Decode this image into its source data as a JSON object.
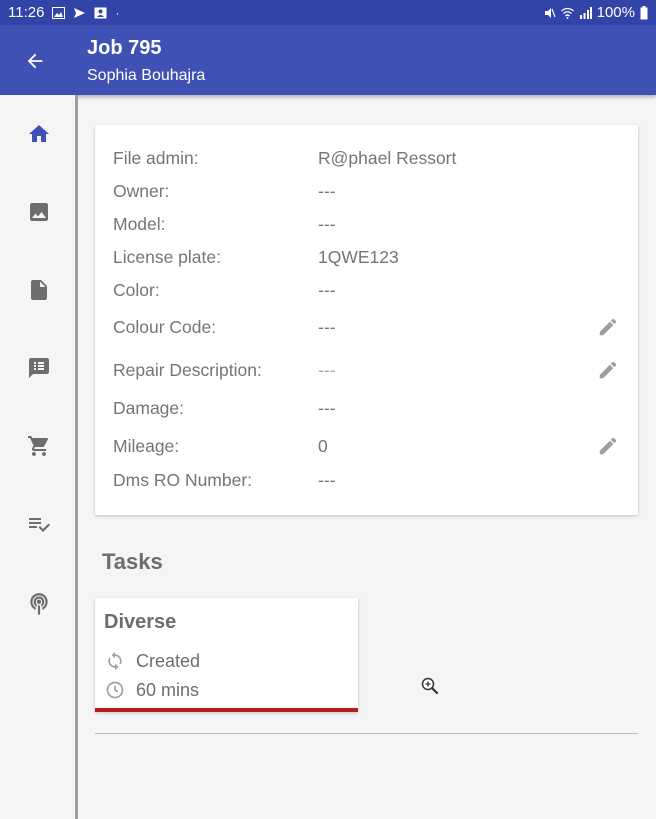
{
  "status_bar": {
    "time": "11:26",
    "battery": "100%"
  },
  "app_bar": {
    "title": "Job 795",
    "subtitle": "Sophia Bouhajra",
    "back_icon": "arrow-back-icon"
  },
  "nav": {
    "items": [
      {
        "name": "home",
        "icon": "home-icon",
        "active": true
      },
      {
        "name": "images",
        "icon": "image-icon",
        "active": false
      },
      {
        "name": "documents",
        "icon": "document-icon",
        "active": false
      },
      {
        "name": "messages",
        "icon": "message-icon",
        "active": false
      },
      {
        "name": "cart",
        "icon": "cart-icon",
        "active": false
      },
      {
        "name": "checklist",
        "icon": "checklist-icon",
        "active": false
      },
      {
        "name": "podcast",
        "icon": "podcast-icon",
        "active": false
      }
    ]
  },
  "info": {
    "rows": [
      {
        "label": "File admin:",
        "value": "R@phael Ressort",
        "editable": false
      },
      {
        "label": "Owner:",
        "value": "---",
        "editable": false
      },
      {
        "label": "Model:",
        "value": "---",
        "editable": false
      },
      {
        "label": "License plate:",
        "value": "1QWE123",
        "editable": false
      },
      {
        "label": "Color:",
        "value": "---",
        "editable": false
      },
      {
        "label": "Colour Code:",
        "value": "---",
        "editable": true
      },
      {
        "label": "Repair Description:",
        "value": "---",
        "editable": true
      },
      {
        "label": "Damage:",
        "value": "---",
        "editable": false
      },
      {
        "label": "Mileage:",
        "value": "0",
        "editable": true
      },
      {
        "label": "Dms RO Number:",
        "value": "---",
        "editable": false
      }
    ]
  },
  "tasks": {
    "heading": "Tasks",
    "items": [
      {
        "title": "Diverse",
        "status": "Created",
        "duration": "60 mins",
        "status_icon": "sync-icon",
        "duration_icon": "clock-icon",
        "accent": "#b71c1c"
      }
    ]
  },
  "colors": {
    "primary": "#3f51b5",
    "status_bar": "#3244a8",
    "text_muted": "#757575",
    "task_accent": "#b71c1c"
  }
}
